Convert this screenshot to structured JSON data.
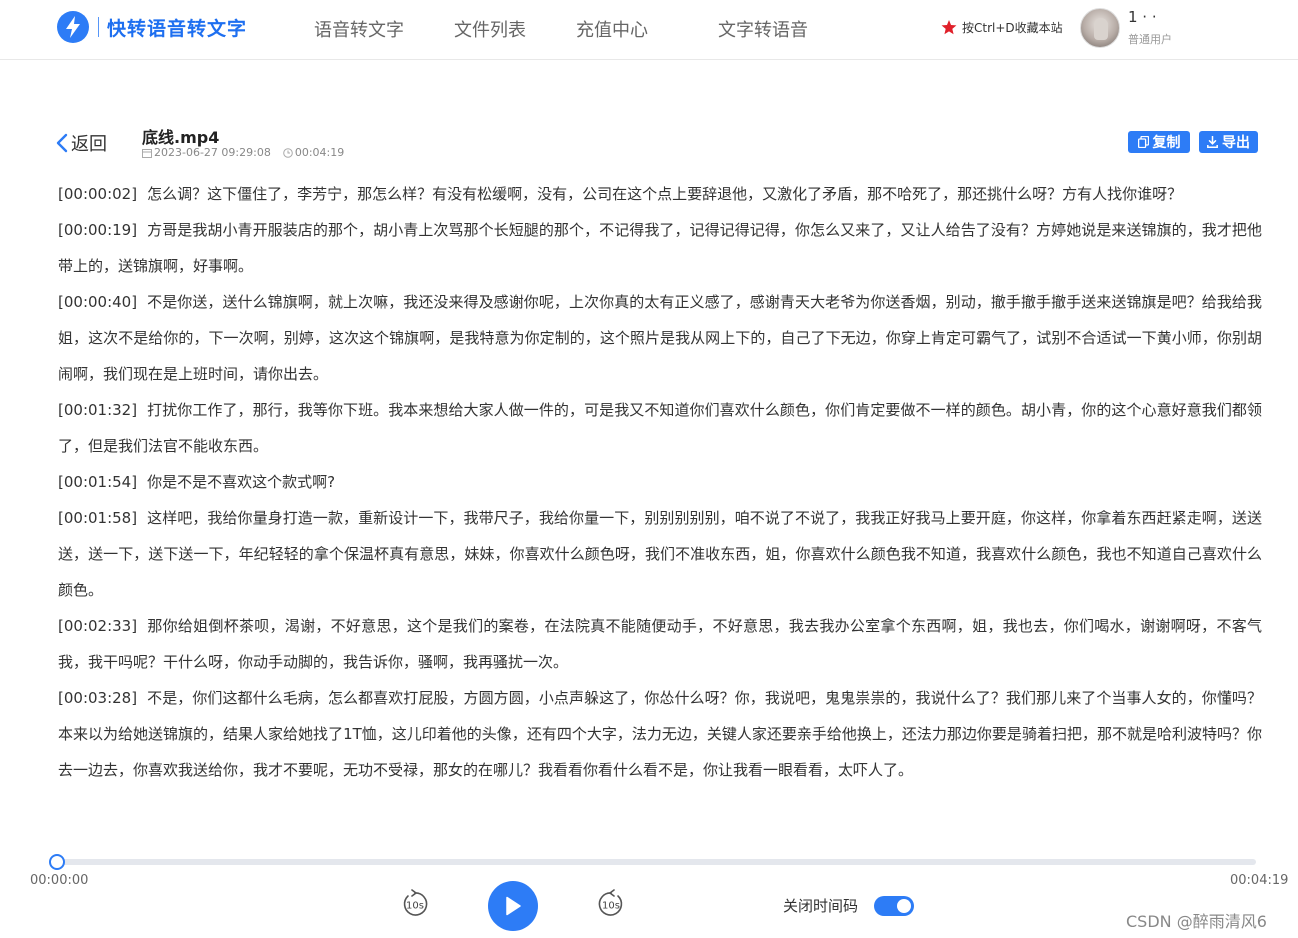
{
  "header": {
    "logo_text": "快转语音转文字",
    "nav": [
      {
        "label": "语音转文字"
      },
      {
        "label": "文件列表"
      },
      {
        "label": "充值中心"
      },
      {
        "label": "文字转语音"
      }
    ],
    "bookmark_hint": "按Ctrl+D收藏本站",
    "user": {
      "name": "1 · ·",
      "role": "普通用户"
    }
  },
  "file": {
    "back_label": "返回",
    "name": "底线.mp4",
    "date": "2023-06-27 09:29:08",
    "duration": "00:04:19",
    "copy_label": "复制",
    "export_label": "导出"
  },
  "transcript": [
    {
      "time": "[00:00:02]",
      "text": "怎么调？这下僵住了，李芳宁，那怎么样？有没有松缓啊，没有，公司在这个点上要辞退他，又激化了矛盾，那不哈死了，那还挑什么呀？方有人找你谁呀？"
    },
    {
      "time": "[00:00:19]",
      "text": "方哥是我胡小青开服装店的那个，胡小青上次骂那个长短腿的那个，不记得我了，记得记得记得，你怎么又来了，又让人给告了没有？方婷她说是来送锦旗的，我才把他带上的，送锦旗啊，好事啊。"
    },
    {
      "time": "[00:00:40]",
      "text": "不是你送，送什么锦旗啊，就上次嘛，我还没来得及感谢你呢，上次你真的太有正义感了，感谢青天大老爷为你送香烟，别动，撤手撤手撤手送来送锦旗是吧？给我给我姐，这次不是给你的，下一次啊，别婷，这次这个锦旗啊，是我特意为你定制的，这个照片是我从网上下的，自己了下无边，你穿上肯定可霸气了，试别不合适试一下黄小师，你别胡闹啊，我们现在是上班时间，请你出去。"
    },
    {
      "time": "[00:01:32]",
      "text": "打扰你工作了，那行，我等你下班。我本来想给大家人做一件的，可是我又不知道你们喜欢什么颜色，你们肯定要做不一样的颜色。胡小青，你的这个心意好意我们都领了，但是我们法官不能收东西。"
    },
    {
      "time": "[00:01:54]",
      "text": "你是不是不喜欢这个款式啊?"
    },
    {
      "time": "[00:01:58]",
      "text": "这样吧，我给你量身打造一款，重新设计一下，我带尺子，我给你量一下，别别别别别，咱不说了不说了，我我正好我马上要开庭，你这样，你拿着东西赶紧走啊，送送送，送一下，送下送一下，年纪轻轻的拿个保温杯真有意思，妹妹，你喜欢什么颜色呀，我们不准收东西，姐，你喜欢什么颜色我不知道，我喜欢什么颜色，我也不知道自己喜欢什么颜色。"
    },
    {
      "time": "[00:02:33]",
      "text": "那你给姐倒杯茶呗，渴谢，不好意思，这个是我们的案卷，在法院真不能随便动手，不好意思，我去我办公室拿个东西啊，姐，我也去，你们喝水，谢谢啊呀，不客气我，我干吗呢？干什么呀，你动手动脚的，我告诉你，骚啊，我再骚扰一次。"
    },
    {
      "time": "[00:03:28]",
      "text": "不是，你们这都什么毛病，怎么都喜欢打屁股，方圆方圆，小点声躲这了，你怂什么呀？你，我说吧，鬼鬼祟祟的，我说什么了？我们那儿来了个当事人女的，你懂吗？本来以为给她送锦旗的，结果人家给她找了1T恤，这儿印着他的头像，还有四个大字，法力无边，关键人家还要亲手给他换上，还法力那边你要是骑着扫把，那不就是哈利波特吗？你去一边去，你喜欢我送给你，我才不要呢，无功不受禄，那女的在哪儿？我看看你看什么看不是，你让我看一眼看看，太吓人了。"
    }
  ],
  "player": {
    "current_time": "00:00:00",
    "total_time": "00:04:19",
    "progress": 0.0,
    "skip_seconds": "10s",
    "timestamp_toggle_label": "关闭时间码",
    "timestamp_toggle_on": true
  },
  "watermark": "CSDN @醉雨清风6",
  "colors": {
    "accent": "#2d7cf6",
    "favorite_star": "#e0202a"
  }
}
